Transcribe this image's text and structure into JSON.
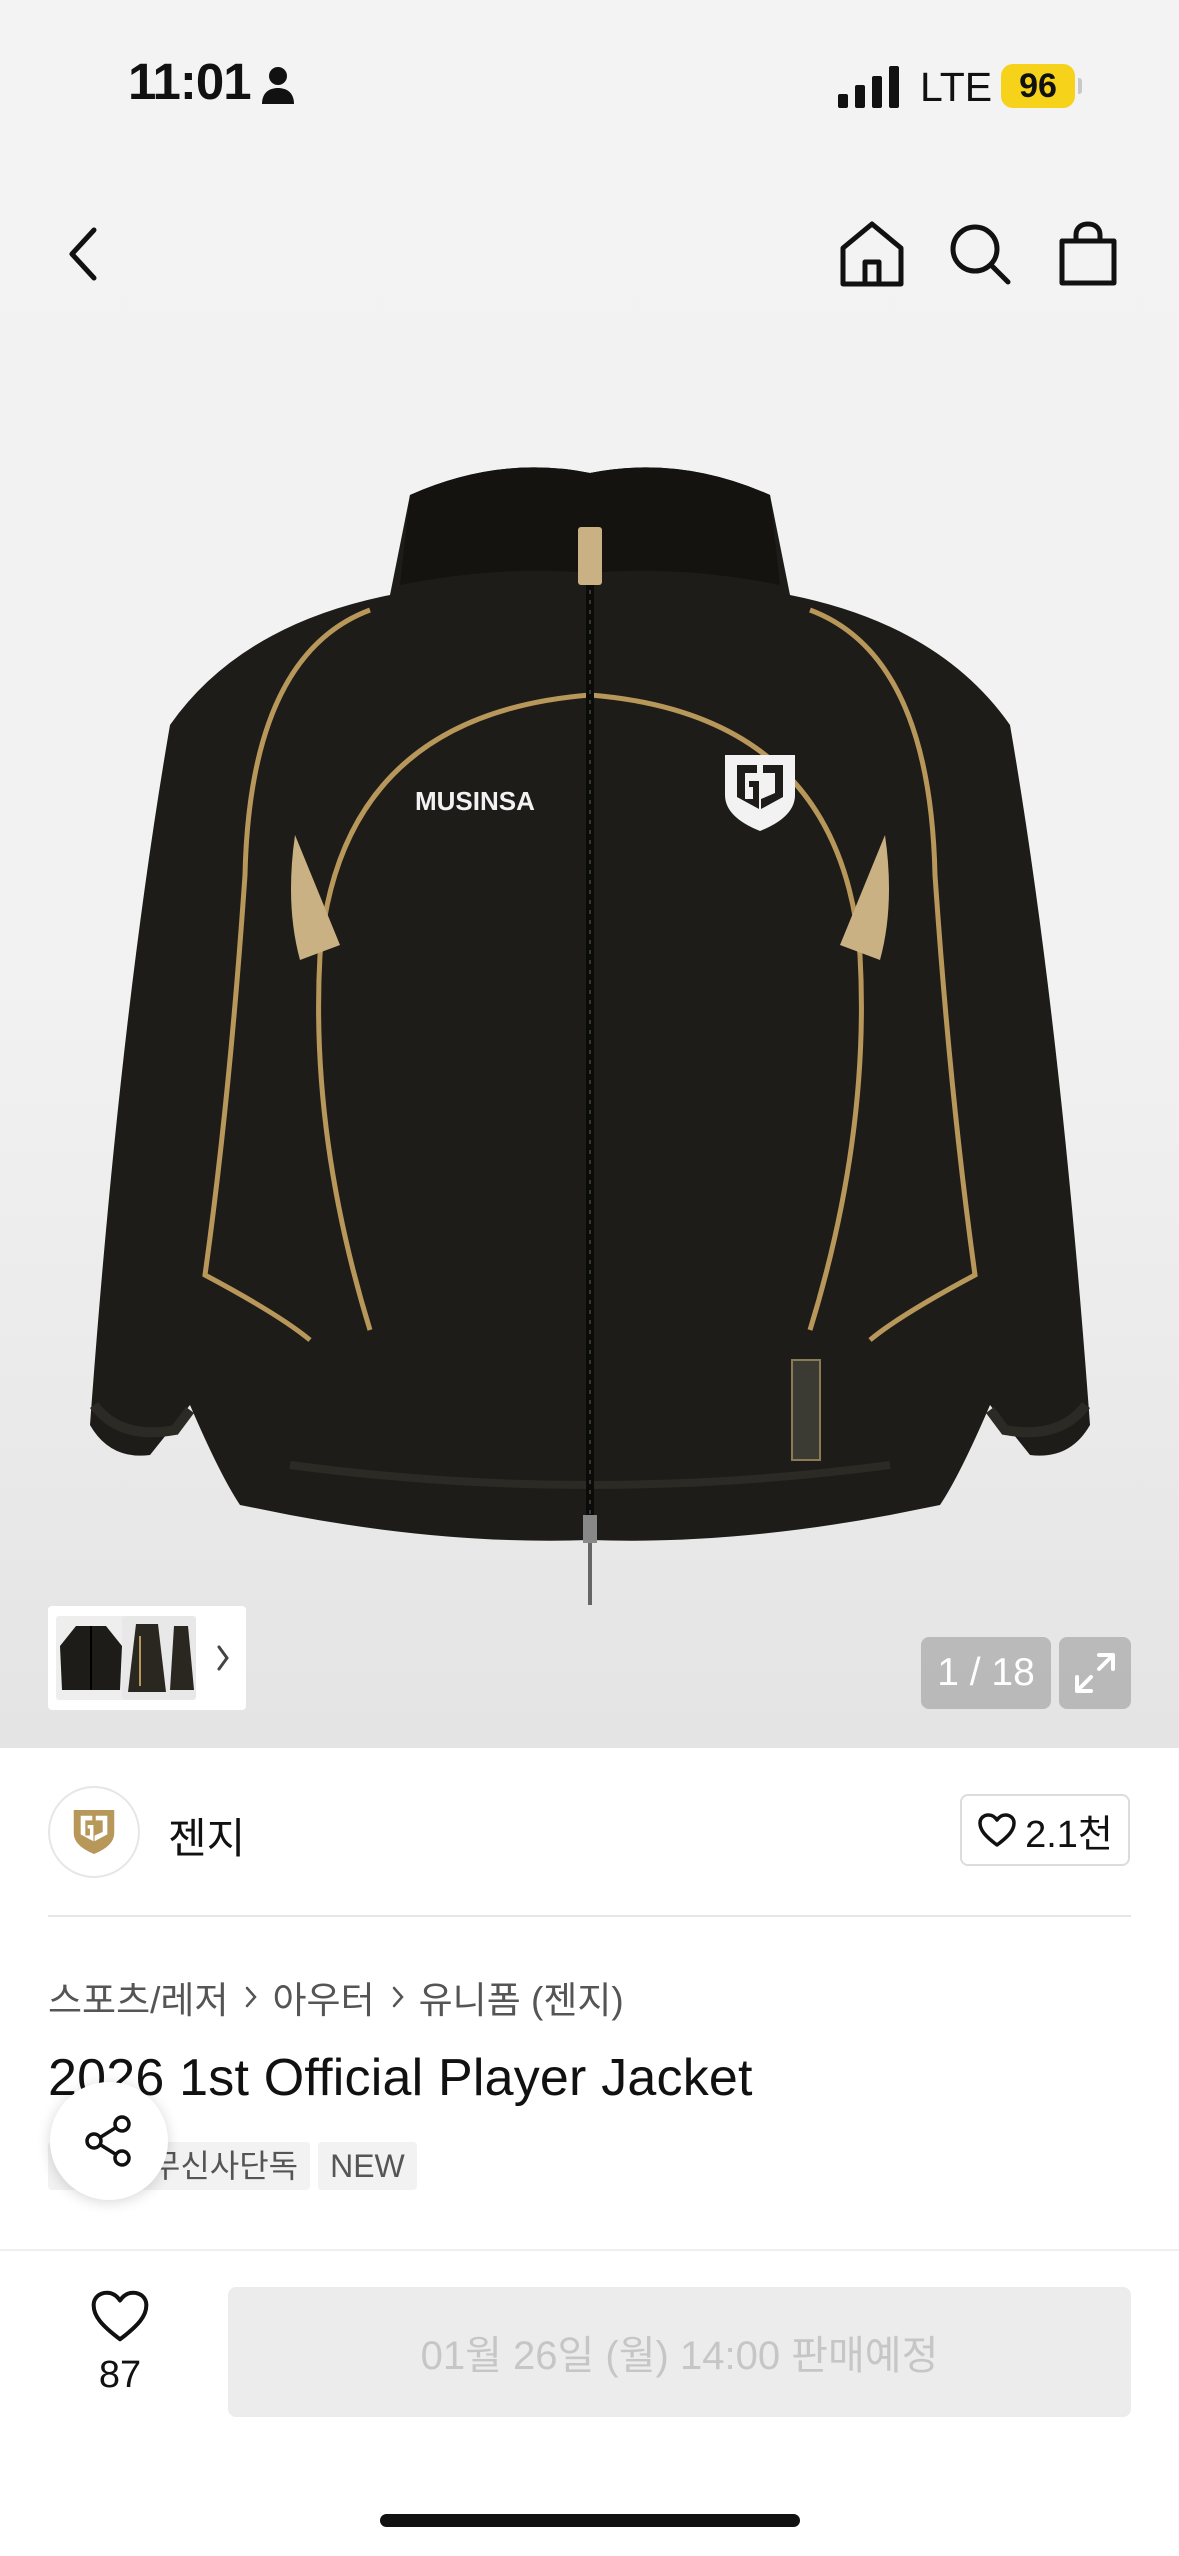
{
  "status_bar": {
    "time": "11:01",
    "network": "LTE",
    "battery": "96"
  },
  "gallery": {
    "counter": "1 / 18",
    "jacket_print": "MUSINSA"
  },
  "brand": {
    "name": "젠지",
    "like_count": "2.1천"
  },
  "breadcrumb": [
    "스포츠/레저",
    "아우터",
    "유니폼 (젠지)"
  ],
  "product": {
    "title": "2026 1st Official Player Jacket",
    "tags": [
      "드롭",
      "무신사단독",
      "NEW"
    ]
  },
  "bottom_bar": {
    "wish_count": "87",
    "buy_label": "01월 26일 (월) 14:00 판매예정"
  },
  "colors": {
    "brand_gold": "#b8975a",
    "battery_yellow": "#f6d21a"
  }
}
